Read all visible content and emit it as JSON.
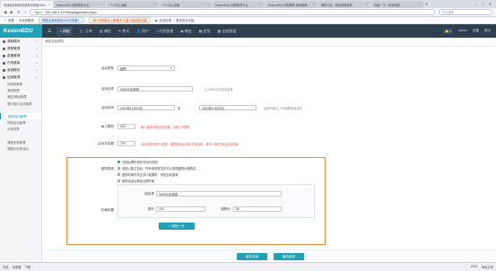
{
  "browser": {
    "tabs": [
      {
        "label": "在线培训系统/在线考试系统-Kesion...",
        "active": true
      },
      {
        "label": "KesionEDU 网校教育平台"
      },
      {
        "label": "个人中心设置"
      },
      {
        "label": "个人中心设置"
      },
      {
        "label": "KesionEDU 网校教育平台"
      },
      {
        "label": "KesionEDU 网校教育 新闻更新"
      },
      {
        "label": "网校平台 - 网站设置选项"
      },
      {
        "label": "百度一下，你就知道"
      }
    ],
    "new_tab": "+",
    "url_scheme": "http://",
    "url": "192.168.1.207/Mnanage/Index.aspx",
    "search_placeholder": "在此搜索",
    "bookmarks": [
      "收藏",
      "手机收藏夹"
    ],
    "bookmark_ads": [
      "想要全面地使用360浏览器？",
      "360 手机助手 | 快速学习/复习网站的功能"
    ],
    "bookmark_extra": [
      "安全检测",
      "更多安全功能"
    ]
  },
  "app": {
    "logo": "KesionEDU",
    "nav": [
      {
        "label": "网校",
        "icon": "home-icon",
        "active": true
      },
      {
        "label": "订单",
        "icon": "cart-icon"
      },
      {
        "label": "课程",
        "icon": "book-icon"
      },
      {
        "label": "考试",
        "icon": "exam-icon"
      },
      {
        "label": "用户",
        "icon": "user-icon"
      },
      {
        "label": "问答管理",
        "icon": "qa-icon"
      },
      {
        "label": "微信",
        "icon": "wechat-icon"
      },
      {
        "label": "应用",
        "icon": "apps-icon"
      },
      {
        "label": "全部频道",
        "icon": "grid-icon"
      }
    ],
    "user": [
      "admin",
      "设置",
      "退出"
    ],
    "bell": "3"
  },
  "sidebar": [
    {
      "type": "group",
      "label": "课程模块"
    },
    {
      "type": "group",
      "label": "课程管理"
    },
    {
      "type": "group",
      "label": "直播管理"
    },
    {
      "type": "group",
      "label": "在线题库"
    },
    {
      "type": "group",
      "label": "营销模块"
    },
    {
      "type": "group",
      "label": "促销管理"
    },
    {
      "type": "item",
      "label": "优惠券管理"
    },
    {
      "type": "item",
      "label": "满减管理"
    },
    {
      "type": "item",
      "label": "满送/满返管理"
    },
    {
      "type": "item",
      "label": "限时特价活动管理"
    },
    {
      "type": "item",
      "label": ""
    },
    {
      "type": "item",
      "label": "团购活动管理",
      "current": true
    },
    {
      "type": "item",
      "label": "拼团活动管理"
    },
    {
      "type": "item",
      "label": "分销设置"
    },
    {
      "type": "item",
      "label": ""
    },
    {
      "type": "item",
      "label": "课程优惠管理"
    },
    {
      "type": "item",
      "label": "课程包优惠活动"
    }
  ],
  "main": {
    "breadcrumb": "添加活动资料",
    "fields": {
      "name_label": "活动名称",
      "name_value": "3000元优惠券",
      "type_label": "活动类型",
      "type_value": "团购",
      "name_hint": "(1-16字以内)活动名称",
      "time_label": "活动时间",
      "time_start": "2020年11月20日",
      "time_sep": "至",
      "time_end": "2020年11月26日",
      "time_hint": "活动时间过了不能再参加活动",
      "limit_label": "每人限购",
      "limit_value": "300",
      "limit_hint": "每人最多可购买的份数，0表示不限购",
      "total_label": "活动总名额",
      "total_value": "700",
      "total_hint": "活动总的可参与名额，团购成功后自动下架活动，参与人数达到后自动结束",
      "rule_label": "团购规则",
      "rules": [
        "开团后需在规定时间内成团",
        "成团人数达到后，所有参团学员均可以按照团购价格购买",
        "团购时间内未达成人数要求，系统自动退款",
        "团购结束后剩余名额作废"
      ],
      "price_label": "价格设置",
      "group_name_label": "团名称",
      "group_name_value": "3000元优惠券",
      "origin_label": "原价",
      "origin_value": "100",
      "group_price_label": "团购价",
      "group_price_value": "50",
      "add_btn": "+ 添加一行"
    },
    "buttons": {
      "save": "保存活动",
      "cancel": "取消返回"
    }
  },
  "status": {
    "left": [
      "完成",
      "加速器",
      "下载"
    ],
    "right": [
      "100%",
      "网络正常"
    ]
  }
}
